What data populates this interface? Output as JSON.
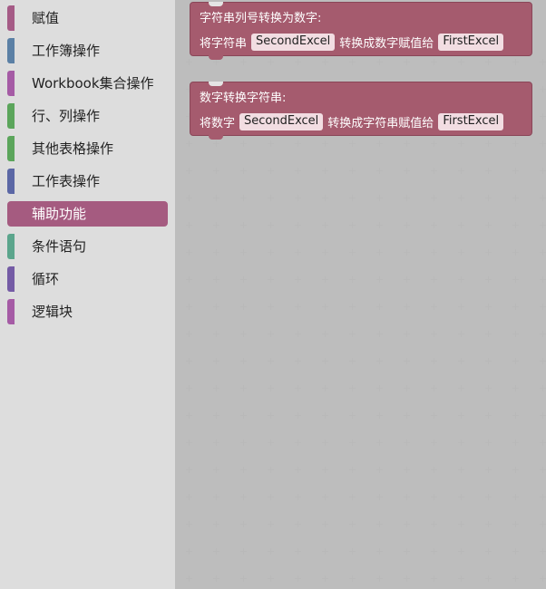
{
  "toolbox": {
    "categories": [
      {
        "label": "赋值",
        "color": "#a55b86"
      },
      {
        "label": "工作簿操作",
        "color": "#5b80a5"
      },
      {
        "label": "Workbook集合操作",
        "color": "#a55ba5"
      },
      {
        "label": "行、列操作",
        "color": "#5ba55b"
      },
      {
        "label": "其他表格操作",
        "color": "#5ba55b"
      },
      {
        "label": "工作表操作",
        "color": "#5b67a5"
      },
      {
        "label": "辅助功能",
        "color": "#a55b80"
      },
      {
        "label": "条件语句",
        "color": "#5ba58c"
      },
      {
        "label": "循环",
        "color": "#745ba5"
      },
      {
        "label": "逻辑块",
        "color": "#a55ba5"
      }
    ],
    "selected_index": 6
  },
  "workspace": {
    "blocks": [
      {
        "title": "字符串列号转换为数字:",
        "prefix": "将字符串",
        "source_field": "SecondExcel",
        "middle": "转换成数字赋值给",
        "target_field": "FirstExcel"
      },
      {
        "title": "数字转换字符串:",
        "prefix": "将数字",
        "source_field": "SecondExcel",
        "middle": "转换成字符串赋值给",
        "target_field": "FirstExcel"
      }
    ],
    "block_color": "#a55b6e"
  }
}
